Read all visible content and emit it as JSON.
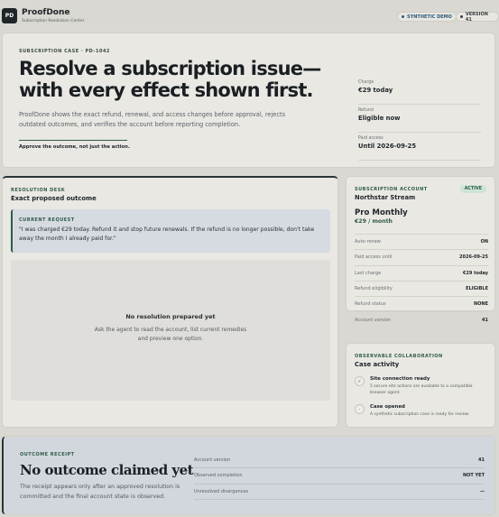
{
  "app": {
    "logo": "PD",
    "brand": "ProofDone",
    "subtitle": "Subscription Resolution Center",
    "badge_demo": "SYNTHETIC DEMO",
    "badge_version": "VERSION 41"
  },
  "hero": {
    "eyebrow": "SUBSCRIPTION CASE · PD-1042",
    "headline": "Resolve a subscription issue—with every effect shown first.",
    "description": "ProofDone shows the exact refund, renewal, and access changes before approval, rejects outdated outcomes, and verifies the account before reporting completion.",
    "tagline": "Approve the outcome, not just the action.",
    "facts": [
      {
        "label": "Charge",
        "value": "€29 today"
      },
      {
        "label": "Refund",
        "value": "Eligible now"
      },
      {
        "label": "Paid access",
        "value": "Until 2026-09-25"
      }
    ]
  },
  "desk": {
    "eyebrow": "RESOLUTION DESK",
    "title": "Exact proposed outcome",
    "request_label": "CURRENT REQUEST",
    "request_text": "\"I was charged €29 today. Refund it and stop future renewals. If the refund is no longer possible, don't take away the month I already paid for.\"",
    "empty_title": "No resolution prepared yet",
    "empty_text": "Ask the agent to read the account, list current remedies and preview one option."
  },
  "account": {
    "eyebrow": "SUBSCRIPTION ACCOUNT",
    "name": "Northstar Stream",
    "status": "ACTIVE",
    "plan": "Pro Monthly",
    "price": "€29 / month",
    "rows": [
      {
        "label": "Auto-renew",
        "value": "ON"
      },
      {
        "label": "Paid access until",
        "value": "2026-09-25"
      },
      {
        "label": "Last charge",
        "value": "€29 today"
      },
      {
        "label": "Refund eligibility",
        "value": "ELIGIBLE"
      },
      {
        "label": "Refund status",
        "value": "NONE"
      },
      {
        "label": "Account version",
        "value": "41"
      }
    ]
  },
  "collab": {
    "eyebrow": "OBSERVABLE COLLABORATION",
    "title": "Case activity",
    "events": [
      {
        "icon": "check-icon",
        "glyph": "✓",
        "title": "Site connection ready",
        "detail": "5 secure site actions are available to a compatible browser agent."
      },
      {
        "icon": "dot-icon",
        "glyph": "·",
        "title": "Case opened",
        "detail": "A synthetic subscription case is ready for review."
      }
    ]
  },
  "receipt": {
    "eyebrow": "OUTCOME RECEIPT",
    "title": "No outcome claimed yet",
    "description": "The receipt appears only after an approved resolution is committed and the final account state is observed.",
    "rows": [
      {
        "label": "Account version",
        "value": "41"
      },
      {
        "label": "Observed completion",
        "value": "NOT YET"
      },
      {
        "label": "Unresolved divergences",
        "value": "—"
      }
    ]
  },
  "colors": {
    "accent": "#2f5b4a",
    "ink": "#1f2428",
    "demo": "#2d5a7a"
  }
}
